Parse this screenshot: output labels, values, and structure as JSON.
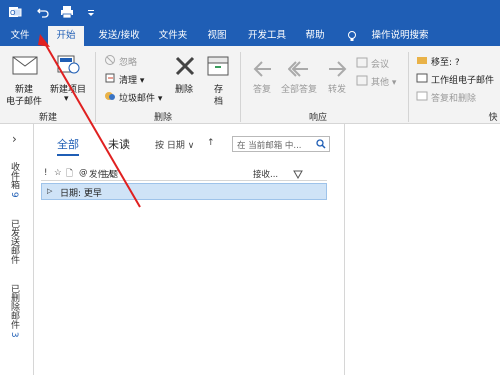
{
  "tabs": [
    "文件",
    "开始",
    "发送/接收",
    "文件夹",
    "视图",
    "开发工具",
    "帮助"
  ],
  "tell_me": "操作说明搜索",
  "ribbon": {
    "new_email": [
      "新建",
      "电子邮件"
    ],
    "new_items": [
      "新建项目",
      "▾"
    ],
    "group_new": "新建",
    "ignore": "忽略",
    "cleanup": "清理 ▾",
    "junk": "垃圾邮件 ▾",
    "delete": "删除",
    "archive": [
      "存",
      "档"
    ],
    "group_delete": "删除",
    "reply": "答复",
    "reply_all": "全部答复",
    "forward": "转发",
    "meeting": "会议",
    "more": "其他 ▾",
    "group_respond": "响应",
    "move_to": "移至: ?",
    "to_manager": "工作组电子邮件",
    "reply_delete": "答复和删除",
    "group_quick": "快"
  },
  "folder_pane": {
    "expand": "›",
    "folders": [
      {
        "label": "收件箱",
        "count": "9"
      },
      {
        "label": "已发送邮件",
        "count": ""
      },
      {
        "label": "已删除邮件",
        "count": "3"
      }
    ]
  },
  "list": {
    "filter_all": "全部",
    "filter_unread": "未读",
    "sort_by": "按 日期 ∨",
    "sort_dir": "↑",
    "search_placeholder": "在 当前邮箱 中...",
    "columns": [
      "!",
      "☆",
      "🗋",
      "@",
      "发件人",
      "主题"
    ],
    "columns_right": "接收...",
    "group_row": "日期: 更早"
  },
  "colors": {
    "accent": "#1f5eb5",
    "arrow": "#e02020",
    "selection": "#cfe3f7"
  }
}
